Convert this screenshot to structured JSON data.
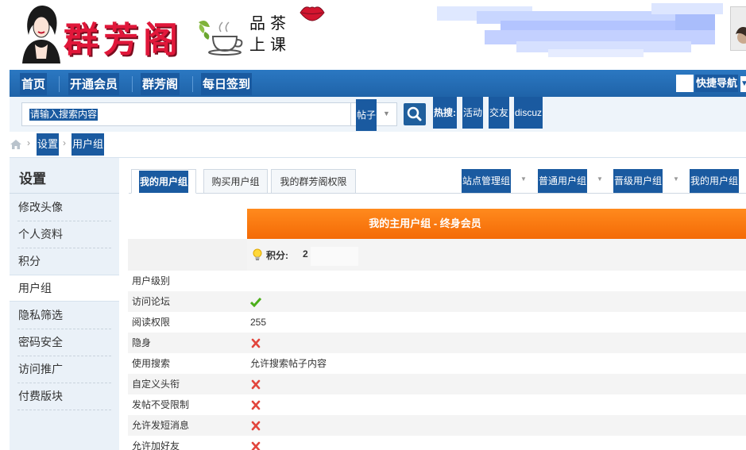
{
  "header": {
    "site_name": "群芳阁",
    "tagline_line1": "品茶",
    "tagline_line2": "上课"
  },
  "nav": {
    "items": [
      {
        "label": "首页"
      },
      {
        "label": "开通会员"
      },
      {
        "label": "群芳阁"
      },
      {
        "label": "每日签到"
      }
    ],
    "quick_nav_label": "快捷导航"
  },
  "search": {
    "placeholder": "请输入搜索内容",
    "type_label": "帖子",
    "hot_label": "热搜:",
    "hot_terms": [
      "活动",
      "交友",
      "discuz"
    ]
  },
  "breadcrumb": {
    "items": [
      "设置",
      "用户组"
    ]
  },
  "sidebar": {
    "title": "设置",
    "items": [
      {
        "label": "修改头像"
      },
      {
        "label": "个人资料"
      },
      {
        "label": "积分"
      },
      {
        "label": "用户组",
        "active": true
      },
      {
        "label": "隐私筛选"
      },
      {
        "label": "密码安全"
      },
      {
        "label": "访问推广"
      },
      {
        "label": "付费版块"
      }
    ]
  },
  "tabs": {
    "items": [
      {
        "label": "我的用户组",
        "active": true
      },
      {
        "label": "购买用户组"
      },
      {
        "label": "我的群芳阁权限"
      }
    ],
    "group_tabs": [
      "站点管理组",
      "普通用户组",
      "晋级用户组",
      "我的用户组"
    ]
  },
  "group": {
    "title": "我的主用户组 - 终身会员",
    "points_label": "积分:",
    "points_value": "2"
  },
  "permissions": [
    {
      "name": "用户级别",
      "kind": "text",
      "value": ""
    },
    {
      "name": "访问论坛",
      "kind": "yes"
    },
    {
      "name": "阅读权限",
      "kind": "text",
      "value": "255"
    },
    {
      "name": "隐身",
      "kind": "no"
    },
    {
      "name": "使用搜索",
      "kind": "text",
      "value": "允许搜索帖子内容"
    },
    {
      "name": "自定义头衔",
      "kind": "no"
    },
    {
      "name": "发帖不受限制",
      "kind": "no"
    },
    {
      "name": "允许发短消息",
      "kind": "no"
    },
    {
      "name": "允许加好友",
      "kind": "no"
    }
  ],
  "colors": {
    "nav_blue": "#1f63a8",
    "highlight_blue": "#1a5aa0",
    "orange": "#f46a06",
    "check_green": "#4caf1a",
    "cross_red": "#e2463d"
  }
}
